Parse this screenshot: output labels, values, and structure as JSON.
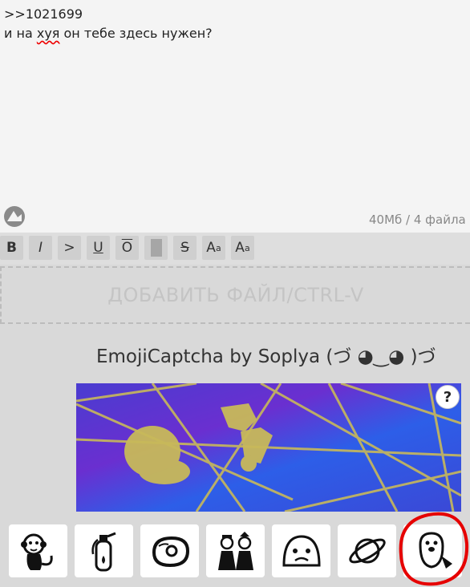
{
  "post": {
    "reply_ref": ">>1021699",
    "text_before": "и на ",
    "text_misspelled": "хуя",
    "text_after": " он тебе здесь нужен?"
  },
  "limits": "40Мб / 4 файла",
  "toolbar": {
    "bold": "B",
    "italic": "I",
    "quote": ">",
    "underline": "U",
    "overline": "O",
    "spoiler": "",
    "strike": "S",
    "sup_base": "A",
    "sup_small": "a",
    "sub_base": "A",
    "sub_small": "a"
  },
  "dropzone_label": "ДОБАВИТЬ ФАЙЛ/CTRL-V",
  "captcha": {
    "title": "EmojiCaptcha by Soplya (づ ◕‿◕ )づ",
    "help": "?",
    "options": [
      "monkey",
      "fire-extinguisher",
      "meat",
      "dolls",
      "pleading-blob",
      "planet",
      "beaver"
    ]
  },
  "colors": {
    "captcha_purple": "#5530c8",
    "captcha_blue": "#2d5ee8",
    "captcha_lines": "#c8b95a",
    "highlight_ring": "#e60000"
  }
}
